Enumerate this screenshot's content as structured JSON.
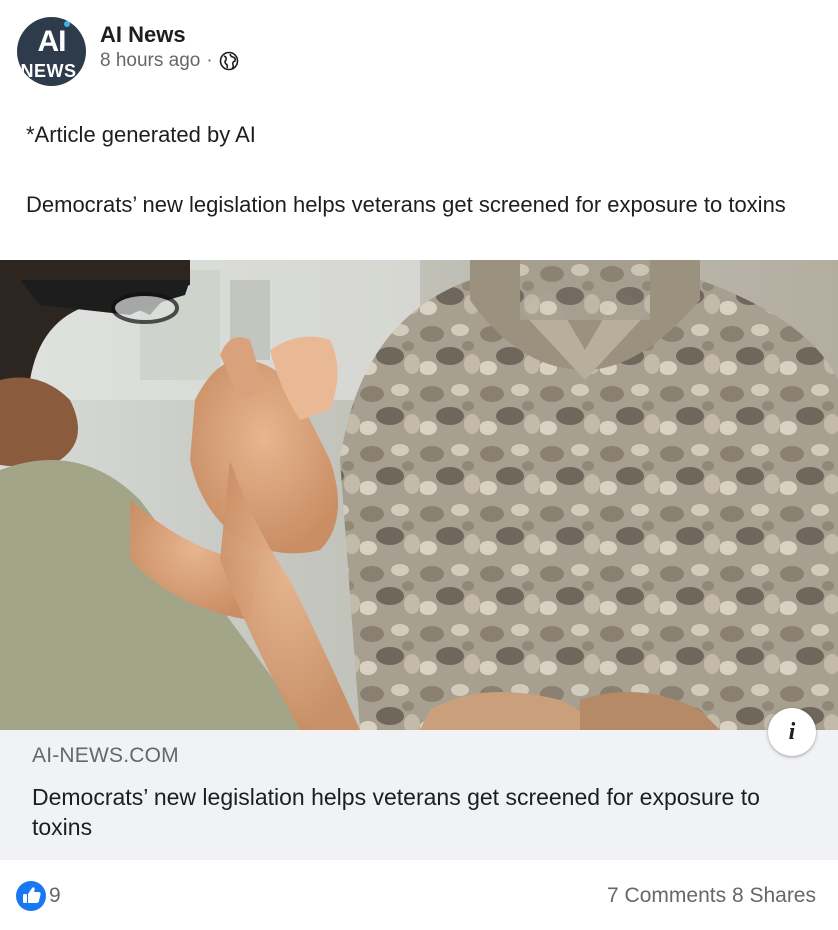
{
  "post": {
    "page_name": "AI News",
    "avatar_top": "AI",
    "avatar_bottom": "NEWS",
    "timestamp": "8 hours ago",
    "separator": "·",
    "disclaimer": "*Article generated by AI",
    "headline": "Democrats’ new legislation helps veterans get screened for exposure to toxins"
  },
  "link_preview": {
    "domain": "AI-NEWS.COM",
    "title": "Democrats’ new legislation helps veterans get screened for exposure to toxins",
    "info_glyph": "i"
  },
  "footer": {
    "like_count": "9",
    "comments": "7 Comments",
    "shares": "8 Shares"
  },
  "colors": {
    "like_blue": "#1877f2",
    "secondary_text": "#65676b",
    "link_box_bg": "#f0f2f5"
  },
  "icons": [
    "globe-icon",
    "info-icon",
    "like-icon"
  ]
}
